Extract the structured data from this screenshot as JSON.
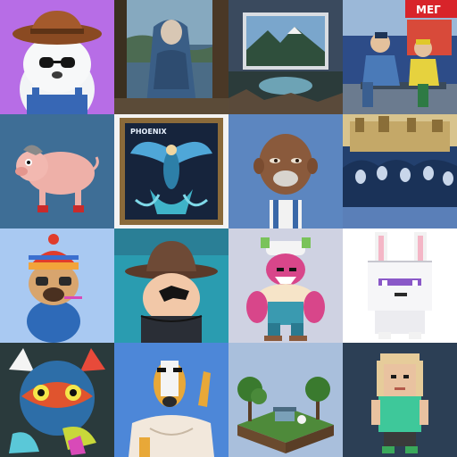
{
  "grid": {
    "tiles": [
      {
        "id": "penguin-cowboy",
        "bg": "#b76de6"
      },
      {
        "id": "blue-robed-figure-painting",
        "bg": "#4b6c86"
      },
      {
        "id": "framed-landscape-painting",
        "bg": "#3a4a5e"
      },
      {
        "id": "comic-men-on-bench",
        "bg": "#2d4c88",
        "sign_text": "МЕГ"
      },
      {
        "id": "cartoon-pig",
        "bg": "#3e6e96"
      },
      {
        "id": "phoenix-card",
        "bg": "#16243c",
        "card_title": "PHOENIX"
      },
      {
        "id": "bald-3d-character",
        "bg": "#5c86c0"
      },
      {
        "id": "blue-engraving-city",
        "bg": "#23406e"
      },
      {
        "id": "pug-with-beanie",
        "bg": "#a9c9f2"
      },
      {
        "id": "cowboy-hat-character",
        "bg": "#2a9cb0"
      },
      {
        "id": "muscular-toy-character",
        "bg": "#cfd2e2"
      },
      {
        "id": "pixel-bunny",
        "bg": "#ffffff"
      },
      {
        "id": "psychedelic-cat",
        "bg": "#2a3a3c"
      },
      {
        "id": "dog-head-muscle-man",
        "bg": "#4d87d8"
      },
      {
        "id": "floating-island",
        "bg": "#a9bfdc"
      },
      {
        "id": "pixel-girl",
        "bg": "#2c3f55"
      }
    ]
  }
}
